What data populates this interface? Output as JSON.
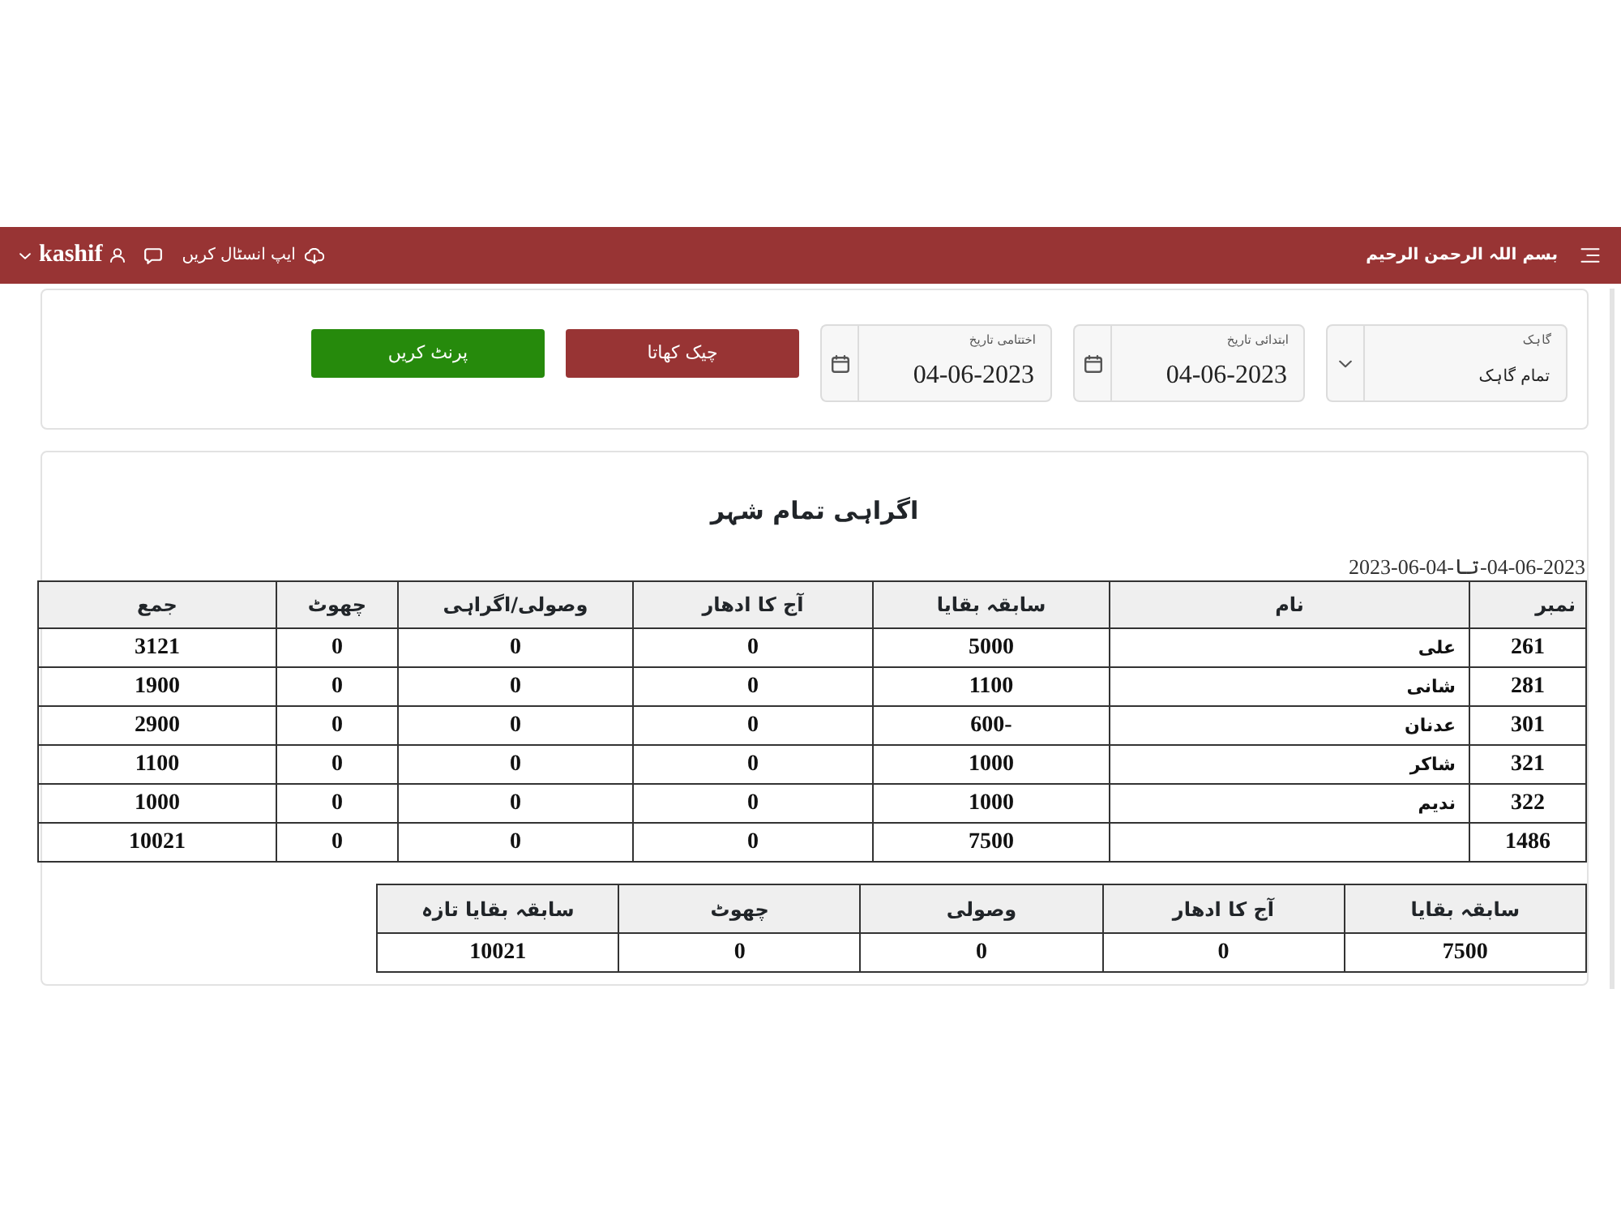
{
  "navbar": {
    "brand": "بسم اللہ الرحمن الرحیم",
    "install_link": "ایپ انسٹال کریں",
    "username": "kashif"
  },
  "filters": {
    "customer": {
      "label": "گاہک",
      "value": "تمام گاہک"
    },
    "dates": [
      {
        "label": "ابتدائی تاریخ",
        "value": "04-06-2023"
      },
      {
        "label": "اختتامی تاریخ",
        "value": "04-06-2023"
      }
    ],
    "buttons": [
      {
        "label": "چیک کھاتا",
        "kind": "ledger"
      },
      {
        "label": "پرنٹ کریں",
        "kind": "print"
      }
    ]
  },
  "report": {
    "title": "اگراہی تمام شہر",
    "date_range": "04-06-2023-تا-04-06-2023",
    "table": {
      "columns": {
        "number": "نمبر",
        "name": "نام",
        "previous_balance": "سابقہ بقایا",
        "today_credit": "آج کا ادھار",
        "collection": "وصولی/اگراہی",
        "discount": "چھوٹ",
        "total": "جمع"
      },
      "rows": [
        {
          "number": "261",
          "name": "علی",
          "previous_balance": "5000",
          "today_credit": "0",
          "collection": "0",
          "discount": "0",
          "total": "3121"
        },
        {
          "number": "281",
          "name": "شانی",
          "previous_balance": "1100",
          "today_credit": "0",
          "collection": "0",
          "discount": "0",
          "total": "1900"
        },
        {
          "number": "301",
          "name": "عدنان",
          "previous_balance": "-600",
          "today_credit": "0",
          "collection": "0",
          "discount": "0",
          "total": "2900"
        },
        {
          "number": "321",
          "name": "شاکر",
          "previous_balance": "1000",
          "today_credit": "0",
          "collection": "0",
          "discount": "0",
          "total": "1100"
        },
        {
          "number": "322",
          "name": "ندیم",
          "previous_balance": "1000",
          "today_credit": "0",
          "collection": "0",
          "discount": "0",
          "total": "1000"
        },
        {
          "number": "1486",
          "previous_balance": "7500",
          "today_credit": "0",
          "collection": "0",
          "discount": "0",
          "total": "10021"
        }
      ]
    },
    "summary": {
      "columns": {
        "previous_balance": "سابقہ بقایا",
        "today_credit": "آج کا ادھار",
        "received": "وصولی",
        "discount": "چھوٹ",
        "new_balance": "سابقہ بقایا تازہ"
      },
      "rows": [
        {
          "previous_balance": "7500",
          "today_credit": "0",
          "received": "0",
          "discount": "0",
          "new_balance": "10021"
        }
      ]
    }
  }
}
